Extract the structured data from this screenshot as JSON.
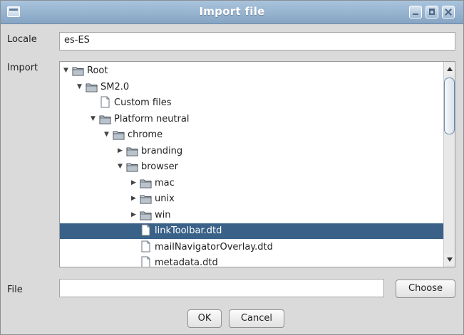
{
  "window": {
    "title": "Import file"
  },
  "locale": {
    "label": "Locale",
    "value": "es-ES"
  },
  "import": {
    "label": "Import"
  },
  "tree": {
    "rows": [
      {
        "label": "Root",
        "type": "folder",
        "expanded": true,
        "level": 0,
        "selected": false
      },
      {
        "label": "SM2.0",
        "type": "folder",
        "expanded": true,
        "level": 1,
        "selected": false
      },
      {
        "label": "Custom files",
        "type": "file",
        "level": 2,
        "selected": false
      },
      {
        "label": "Platform neutral",
        "type": "folder",
        "expanded": true,
        "level": 2,
        "selected": false
      },
      {
        "label": "chrome",
        "type": "folder",
        "expanded": true,
        "level": 3,
        "selected": false
      },
      {
        "label": "branding",
        "type": "folder",
        "expanded": false,
        "level": 4,
        "selected": false
      },
      {
        "label": "browser",
        "type": "folder",
        "expanded": true,
        "level": 4,
        "selected": false
      },
      {
        "label": "mac",
        "type": "folder",
        "expanded": false,
        "level": 5,
        "selected": false
      },
      {
        "label": "unix",
        "type": "folder",
        "expanded": false,
        "level": 5,
        "selected": false
      },
      {
        "label": "win",
        "type": "folder",
        "expanded": false,
        "level": 5,
        "selected": false
      },
      {
        "label": "linkToolbar.dtd",
        "type": "file",
        "level": 5,
        "selected": true
      },
      {
        "label": "mailNavigatorOverlay.dtd",
        "type": "file",
        "level": 5,
        "selected": false
      },
      {
        "label": "metadata.dtd",
        "type": "file",
        "level": 5,
        "selected": false
      }
    ]
  },
  "file": {
    "label": "File",
    "value": "",
    "choose_label": "Choose"
  },
  "buttons": {
    "ok": "OK",
    "cancel": "Cancel"
  },
  "colors": {
    "selection": "#3a6289",
    "titlebar": "#9ab5d1"
  }
}
